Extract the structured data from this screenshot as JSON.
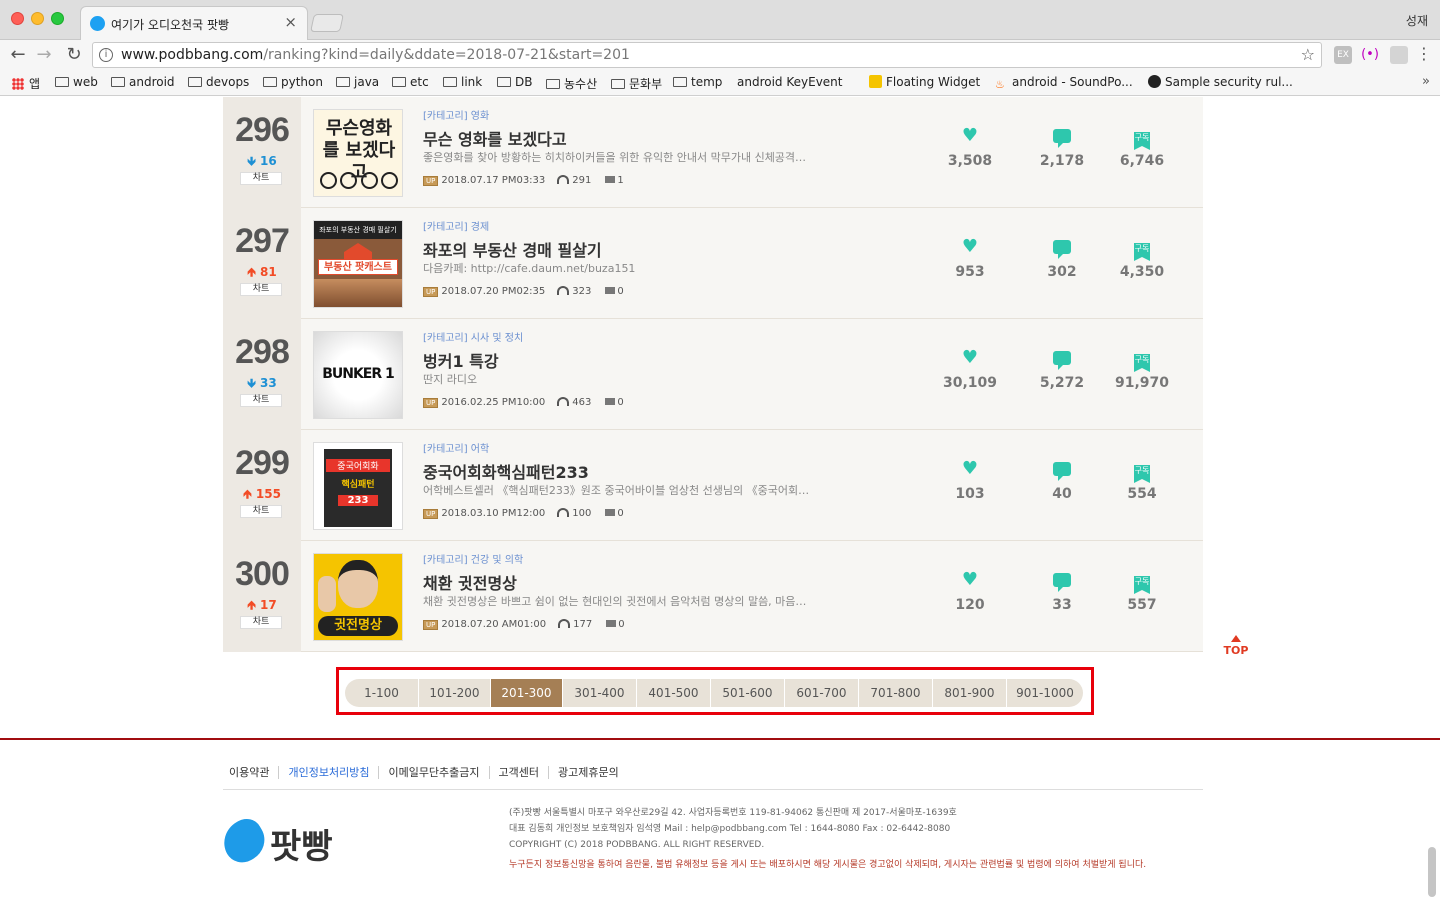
{
  "browser": {
    "tab_title": "여기가 오디오천국 팟빵",
    "tab_close": "×",
    "profile_name": "성재",
    "url_host": "www.podbbang.com",
    "url_path": "/ranking?kind=daily&ddate=2018-07-21&start=201",
    "ext1": "EX",
    "ext2": "(•)",
    "bookmarks": [
      {
        "label": "앱",
        "type": "apps"
      },
      {
        "label": "web",
        "type": "folder"
      },
      {
        "label": "android",
        "type": "folder"
      },
      {
        "label": "devops",
        "type": "folder"
      },
      {
        "label": "python",
        "type": "folder"
      },
      {
        "label": "java",
        "type": "folder"
      },
      {
        "label": "etc",
        "type": "folder"
      },
      {
        "label": "link",
        "type": "folder"
      },
      {
        "label": "DB",
        "type": "folder"
      },
      {
        "label": "농수산",
        "type": "folder"
      },
      {
        "label": "문화부",
        "type": "folder"
      },
      {
        "label": "temp",
        "type": "folder"
      },
      {
        "label": "android KeyEvent",
        "type": "page"
      },
      {
        "label": "Floating Widget",
        "type": "fw"
      },
      {
        "label": "android - SoundPo...",
        "type": "sp"
      },
      {
        "label": "Sample security rul...",
        "type": "gh"
      }
    ]
  },
  "chart_label": "차트",
  "rows": [
    {
      "rank": "296",
      "dir": "down",
      "arrow": "🡻",
      "change": "16",
      "category": "[카테고리] 영화",
      "title": "무슨 영화를 보겠다고",
      "desc": "좋은영화를 찾아 방황하는 히치하이커들을 위한 유익한 안내서 막무가내 신체공격…",
      "up": "UP",
      "date": "2018.07.17 PM03:33",
      "listens": "291",
      "videos": "1",
      "likes": "3,508",
      "comments": "2,178",
      "subs": "6,746"
    },
    {
      "rank": "297",
      "dir": "up",
      "arrow": "🡹",
      "change": "81",
      "category": "[카테고리] 경제",
      "title": "좌포의 부동산 경매 필살기",
      "desc": "다음카페: http://cafe.daum.net/buza151",
      "up": "UP",
      "date": "2018.07.20 PM02:35",
      "listens": "323",
      "videos": "0",
      "likes": "953",
      "comments": "302",
      "subs": "4,350"
    },
    {
      "rank": "298",
      "dir": "down",
      "arrow": "🡻",
      "change": "33",
      "category": "[카테고리] 시사 및 정치",
      "title": "벙커1 특강",
      "desc": "딴지 라디오",
      "up": "UP",
      "date": "2016.02.25 PM10:00",
      "listens": "463",
      "videos": "0",
      "likes": "30,109",
      "comments": "5,272",
      "subs": "91,970"
    },
    {
      "rank": "299",
      "dir": "up",
      "arrow": "🡹",
      "change": "155",
      "category": "[카테고리] 어학",
      "title": "중국어회화핵심패턴233",
      "desc": "어학베스트셀러 《핵심패턴233》원조 중국어바이블 엄상천 선생님의 《중국어회화…",
      "up": "UP",
      "date": "2018.03.10 PM12:00",
      "listens": "100",
      "videos": "0",
      "likes": "103",
      "comments": "40",
      "subs": "554"
    },
    {
      "rank": "300",
      "dir": "up",
      "arrow": "🡹",
      "change": "17",
      "category": "[카테고리] 건강 및 의학",
      "title": "채환 귓전명상",
      "desc": "채환 귓전명상은 바쁘고 쉼이 없는 현대인의 귓전에서 음악처럼 명상의 말씀, 마음…",
      "up": "UP",
      "date": "2018.07.20 AM01:00",
      "listens": "177",
      "videos": "0",
      "likes": "120",
      "comments": "33",
      "subs": "557"
    }
  ],
  "thumbs": {
    "t296": "무슨영화를 보겠다고",
    "t297_top": "좌포의 부동산 경매 필살기",
    "t297_mid": "부동산 팟캐스트",
    "t298": "BUNKER 1",
    "t299_a": "중국어회화",
    "t299_b": "핵심패턴",
    "t299_c": "233",
    "t300": "귓전명상"
  },
  "subscribe_label": "구독",
  "top_label": "TOP",
  "pagination": {
    "pages": [
      "1-100",
      "101-200",
      "201-300",
      "301-400",
      "401-500",
      "501-600",
      "601-700",
      "701-800",
      "801-900",
      "901-1000"
    ],
    "active": "201-300"
  },
  "footer": {
    "links": [
      "이용약관",
      "개인정보처리방침",
      "이메일무단추출금지",
      "고객센터",
      "광고제휴문의"
    ],
    "logo_text": "팟빵",
    "line1": "(주)팟빵 서울특별시 마포구 와우산로29길 42. 사업자등록번호 119-81-94062 통신판매 제 2017-서울마포-1639호",
    "line2": "대표 김동희 개인정보 보호책임자 임석영 Mail : help@podbbang.com Tel : 1644-8080 Fax : 02-6442-8080",
    "line3": "COPYRIGHT (C) 2018 PODBBANG. ALL RIGHT RESERVED.",
    "warning": "누구든지 정보통신망을 통하여 음란물, 불법 유해정보 등을 게시 또는 배포하시면 해당 게시물은 경고없이 삭제되며, 게시자는 관련법률 및 법령에 의하여 처벌받게 됩니다."
  }
}
